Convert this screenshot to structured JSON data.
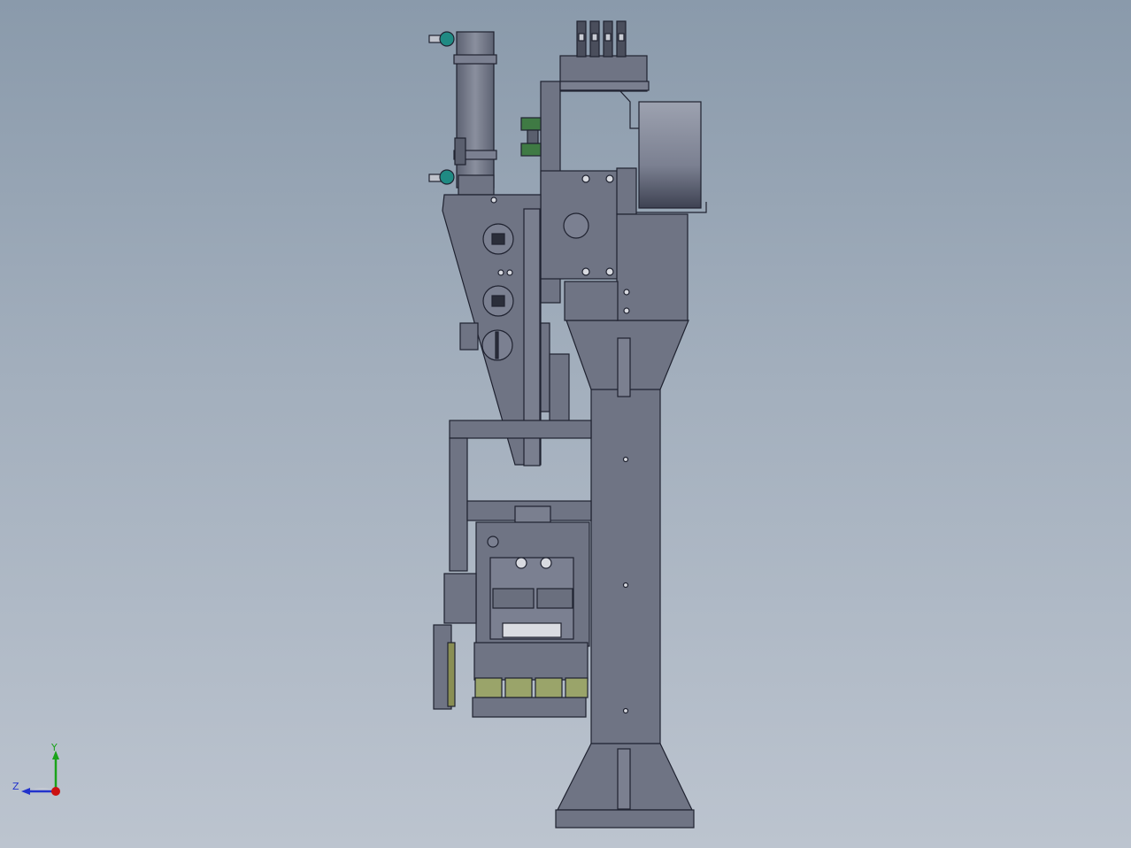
{
  "viewport": {
    "background_top": "#8a9aab",
    "background_bottom": "#bcc4cf"
  },
  "model": {
    "body_color": "#6f7484",
    "edge_color": "#1f2230",
    "accent_teal": "#1f8a83",
    "accent_green": "#3f7a44",
    "accent_olive": "#9aa46a"
  },
  "triad": {
    "x_label": "",
    "y_label": "Y",
    "z_label": "Z",
    "y_color": "#1aa31a",
    "z_color": "#2233cc",
    "origin_color": "#cc1111"
  }
}
